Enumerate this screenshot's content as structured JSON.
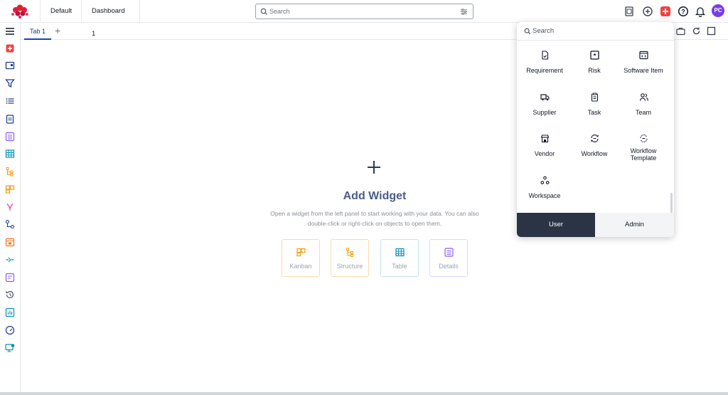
{
  "topbar": {
    "tabs": [
      "Default",
      "Dashboard 1"
    ],
    "search_placeholder": "Search",
    "avatar_initials": "PC"
  },
  "tabs": {
    "active": "Tab 1",
    "add": "+"
  },
  "main": {
    "plus": "+",
    "title": "Add Widget",
    "description_line1": "Open a widget from the left panel to start working with your data. You can also",
    "description_line2": "double-click or right-click on objects to open them.",
    "widgets": [
      {
        "label": "Kanban",
        "color": "#f59e0b"
      },
      {
        "label": "Structure",
        "color": "#f59e0b"
      },
      {
        "label": "Table",
        "color": "#0891b2"
      },
      {
        "label": "Details",
        "color": "#8b5cf6"
      }
    ]
  },
  "dropdown": {
    "search_placeholder": "Search",
    "items": [
      {
        "label": "Requirement",
        "icon": "requirement-icon"
      },
      {
        "label": "Risk",
        "icon": "risk-icon"
      },
      {
        "label": "Software Item",
        "icon": "software-item-icon"
      },
      {
        "label": "Supplier",
        "icon": "supplier-icon"
      },
      {
        "label": "Task",
        "icon": "task-icon"
      },
      {
        "label": "Team",
        "icon": "team-icon"
      },
      {
        "label": "Vendor",
        "icon": "vendor-icon"
      },
      {
        "label": "Workflow",
        "icon": "workflow-icon"
      },
      {
        "label": "Workflow Template",
        "icon": "workflow-template-icon"
      },
      {
        "label": "Workspace",
        "icon": "workspace-icon"
      }
    ],
    "tab_user": "User",
    "tab_admin": "Admin"
  },
  "colors": {
    "accent": "#1e40af",
    "brand": "#e11d48",
    "avatar": "#7c3aed",
    "dark_tab": "#2b3444"
  }
}
